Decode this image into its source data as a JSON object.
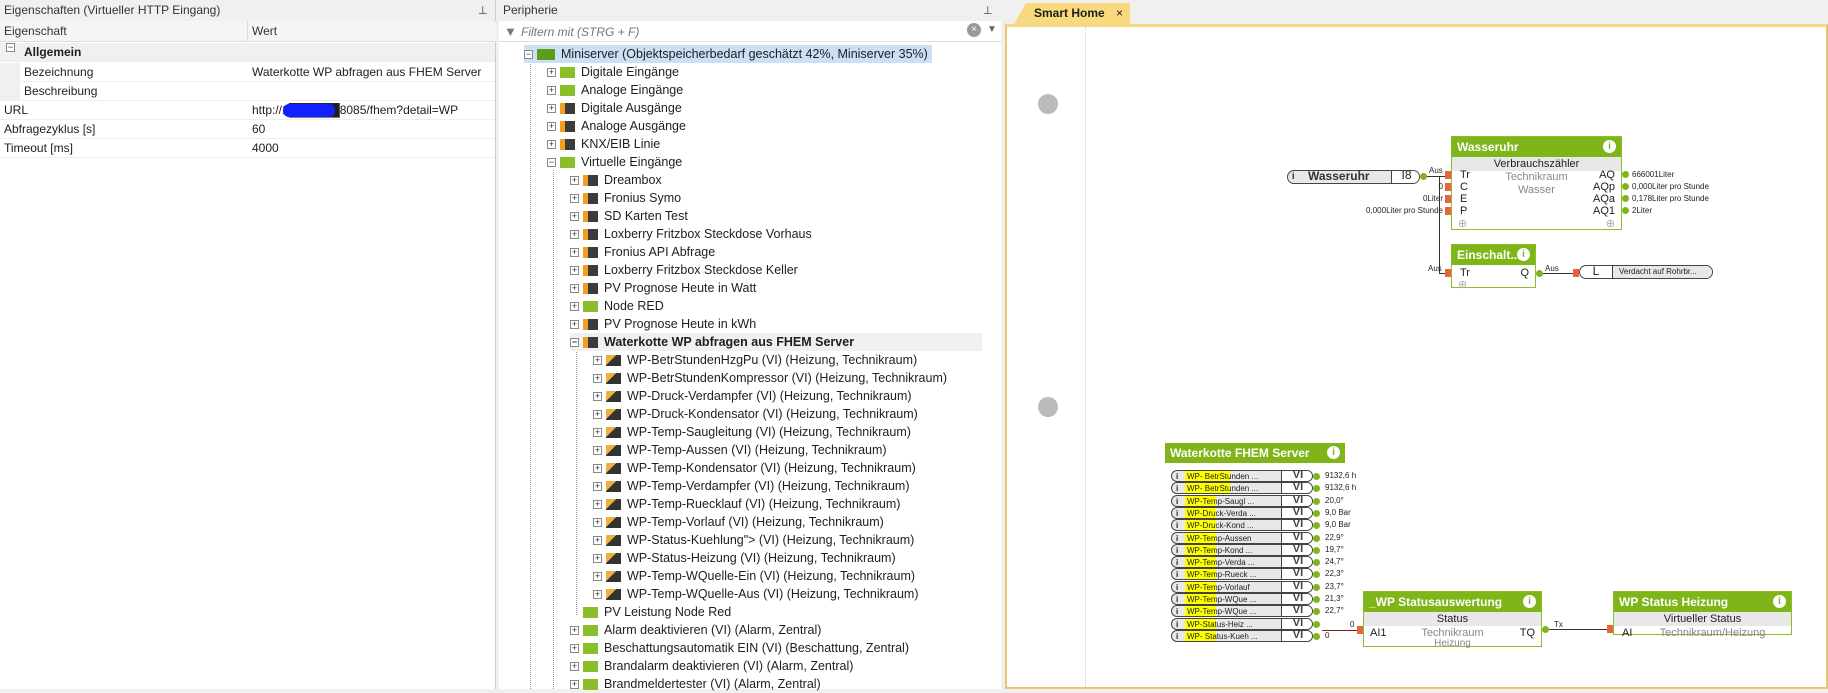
{
  "props": {
    "title": "Eigenschaften (Virtueller HTTP Eingang)",
    "col_prop": "Eigenschaft",
    "col_val": "Wert",
    "group": "Allgemein",
    "rows": [
      {
        "k": "Bezeichnung",
        "v": "Waterkotte WP abfragen aus FHEM Server"
      },
      {
        "k": "Beschreibung",
        "v": ""
      },
      {
        "k": "URL",
        "v": "http://1██████8085/fhem?detail=WP"
      },
      {
        "k": "Abfragezyklus [s]",
        "v": "60"
      },
      {
        "k": "Timeout [ms]",
        "v": "4000"
      }
    ]
  },
  "tree": {
    "title": "Peripherie",
    "filter_placeholder": "Filtern mit (STRG + F)",
    "root": "Miniserver (Objektspeicherbedarf geschätzt 42%, Miniserver 35%)",
    "items": [
      {
        "l": 1,
        "t": "Digitale Eingänge",
        "i": "di"
      },
      {
        "l": 1,
        "t": "Analoge Eingänge",
        "i": "ai"
      },
      {
        "l": 1,
        "t": "Digitale Ausgänge",
        "i": "do"
      },
      {
        "l": 1,
        "t": "Analoge Ausgänge",
        "i": "ao"
      },
      {
        "l": 1,
        "t": "KNX/EIB Linie",
        "i": "knx"
      },
      {
        "l": 1,
        "t": "Virtuelle Eingänge",
        "i": "vi",
        "open": true
      },
      {
        "l": 2,
        "t": "Dreambox",
        "i": "vs"
      },
      {
        "l": 2,
        "t": "Fronius Symo",
        "i": "vs"
      },
      {
        "l": 2,
        "t": "SD Karten Test",
        "i": "vs"
      },
      {
        "l": 2,
        "t": "Loxberry Fritzbox Steckdose Vorhaus",
        "i": "vs"
      },
      {
        "l": 2,
        "t": "Fronius API Abfrage",
        "i": "vs"
      },
      {
        "l": 2,
        "t": "Loxberry Fritzbox Steckdose Keller",
        "i": "vs"
      },
      {
        "l": 2,
        "t": "PV Prognose  Heute in Watt",
        "i": "vs"
      },
      {
        "l": 2,
        "t": "Node RED",
        "i": "vi"
      },
      {
        "l": 2,
        "t": "PV Prognose  Heute in kWh",
        "i": "vs"
      },
      {
        "l": 2,
        "t": "Waterkotte WP abfragen aus FHEM Server",
        "i": "vs",
        "open": true,
        "bold": true
      },
      {
        "l": 3,
        "t": "WP-BetrStundenHzgPu (VI) (Heizung, Technikraum)",
        "i": "sub"
      },
      {
        "l": 3,
        "t": "WP-BetrStundenKompressor (VI) (Heizung, Technikraum)",
        "i": "sub"
      },
      {
        "l": 3,
        "t": "WP-Druck-Verdampfer (VI) (Heizung, Technikraum)",
        "i": "sub"
      },
      {
        "l": 3,
        "t": "WP-Druck-Kondensator (VI) (Heizung, Technikraum)",
        "i": "sub"
      },
      {
        "l": 3,
        "t": "WP-Temp-Saugleitung (VI) (Heizung, Technikraum)",
        "i": "sub"
      },
      {
        "l": 3,
        "t": "WP-Temp-Aussen (VI) (Heizung, Technikraum)",
        "i": "sub"
      },
      {
        "l": 3,
        "t": "WP-Temp-Kondensator (VI) (Heizung, Technikraum)",
        "i": "sub"
      },
      {
        "l": 3,
        "t": "WP-Temp-Verdampfer (VI) (Heizung, Technikraum)",
        "i": "sub"
      },
      {
        "l": 3,
        "t": "WP-Temp-Ruecklauf (VI) (Heizung, Technikraum)",
        "i": "sub"
      },
      {
        "l": 3,
        "t": "WP-Temp-Vorlauf (VI) (Heizung, Technikraum)",
        "i": "sub"
      },
      {
        "l": 3,
        "t": "WP-Status-Kuehlung\"> (VI) (Heizung, Technikraum)",
        "i": "sub"
      },
      {
        "l": 3,
        "t": "WP-Status-Heizung (VI) (Heizung, Technikraum)",
        "i": "sub"
      },
      {
        "l": 3,
        "t": "WP-Temp-WQuelle-Ein (VI) (Heizung, Technikraum)",
        "i": "sub"
      },
      {
        "l": 3,
        "t": "WP-Temp-WQuelle-Aus (VI) (Heizung, Technikraum)",
        "i": "sub"
      },
      {
        "l": 2,
        "t": "PV Leistung Node Red",
        "i": "vi",
        "leaf": true
      },
      {
        "l": 2,
        "t": "Alarm deaktivieren (VI) (Alarm, Zentral)",
        "i": "vi"
      },
      {
        "l": 2,
        "t": "Beschattungsautomatik EIN (VI) (Beschattung, Zentral)",
        "i": "vi"
      },
      {
        "l": 2,
        "t": "Brandalarm deaktivieren (VI) (Alarm, Zentral)",
        "i": "vi"
      },
      {
        "l": 2,
        "t": "Brandmeldertester (VI) (Alarm, Zentral)",
        "i": "vi"
      }
    ]
  },
  "canvas": {
    "tab": "Smart Home",
    "tab_close": "×",
    "wasseruhr_input": {
      "name": "Wasseruhr",
      "type": "I8",
      "out": "Aus"
    },
    "wasseruhr_block": {
      "title": "Wasseruhr",
      "subtitle": "Verbrauchszähler",
      "room": "Technikraum",
      "category": "Wasser",
      "inputs": [
        {
          "n": "Tr",
          "v": ""
        },
        {
          "n": "C",
          "v": "0"
        },
        {
          "n": "E",
          "v": "0Liter"
        },
        {
          "n": "P",
          "v": "0,000Liter pro Stunde"
        }
      ],
      "outputs": [
        {
          "n": "AQ",
          "v": "666001Liter"
        },
        {
          "n": "AQp",
          "v": "0,000Liter pro Stunde"
        },
        {
          "n": "AQa",
          "v": "0,178Liter pro Stunde"
        },
        {
          "n": "AQ1",
          "v": "2Liter"
        }
      ]
    },
    "einschalt": {
      "title": "Einschalt...",
      "in": "Tr",
      "in_label": "Aus",
      "out": "Q",
      "out_label": "Aus"
    },
    "rohrbruch": {
      "type": "L",
      "name": "Verdacht auf Rohrbr..."
    },
    "fhem": {
      "title": "Waterkotte FHEM Server",
      "type": "VI",
      "rows": [
        {
          "n": "WP- BetrStunden ...",
          "v": "9132,6 h"
        },
        {
          "n": "WP- BetrStunden ...",
          "v": "9132,6 h"
        },
        {
          "n": "WP-Temp-Saugl ...",
          "v": "20,0°"
        },
        {
          "n": "WP-Druck-Verda ...",
          "v": "9,0 Bar"
        },
        {
          "n": "WP-Druck-Kond ...",
          "v": "9,0 Bar"
        },
        {
          "n": "WP-Temp-Aussen",
          "v": "22,9°"
        },
        {
          "n": "WP-Temp-Kond ...",
          "v": "19,7°"
        },
        {
          "n": "WP-Temp-Verda ...",
          "v": "24,7°"
        },
        {
          "n": "WP-Temp-Rueck ...",
          "v": "22,3°"
        },
        {
          "n": "WP-Temp-Vorlauf",
          "v": "23,7°"
        },
        {
          "n": "WP-Temp-WQue ...",
          "v": "21,3°"
        },
        {
          "n": "WP-Temp-WQue ...",
          "v": "22,7°"
        },
        {
          "n": "WP-Status-Heiz ...",
          "v": ""
        },
        {
          "n": "WP- Status-Kueh ...",
          "v": "0"
        }
      ]
    },
    "status": {
      "title": "_WP Statusauswertung",
      "subtitle": "Status",
      "in": "AI1",
      "in_val": "0",
      "room": "Technikraum",
      "category": "Heizung",
      "out": "TQ",
      "out_label": "Tx"
    },
    "heizung": {
      "title": "WP Status Heizung",
      "subtitle": "Virtueller Status",
      "in": "AI",
      "location": "Technikraum/Heizung"
    }
  }
}
